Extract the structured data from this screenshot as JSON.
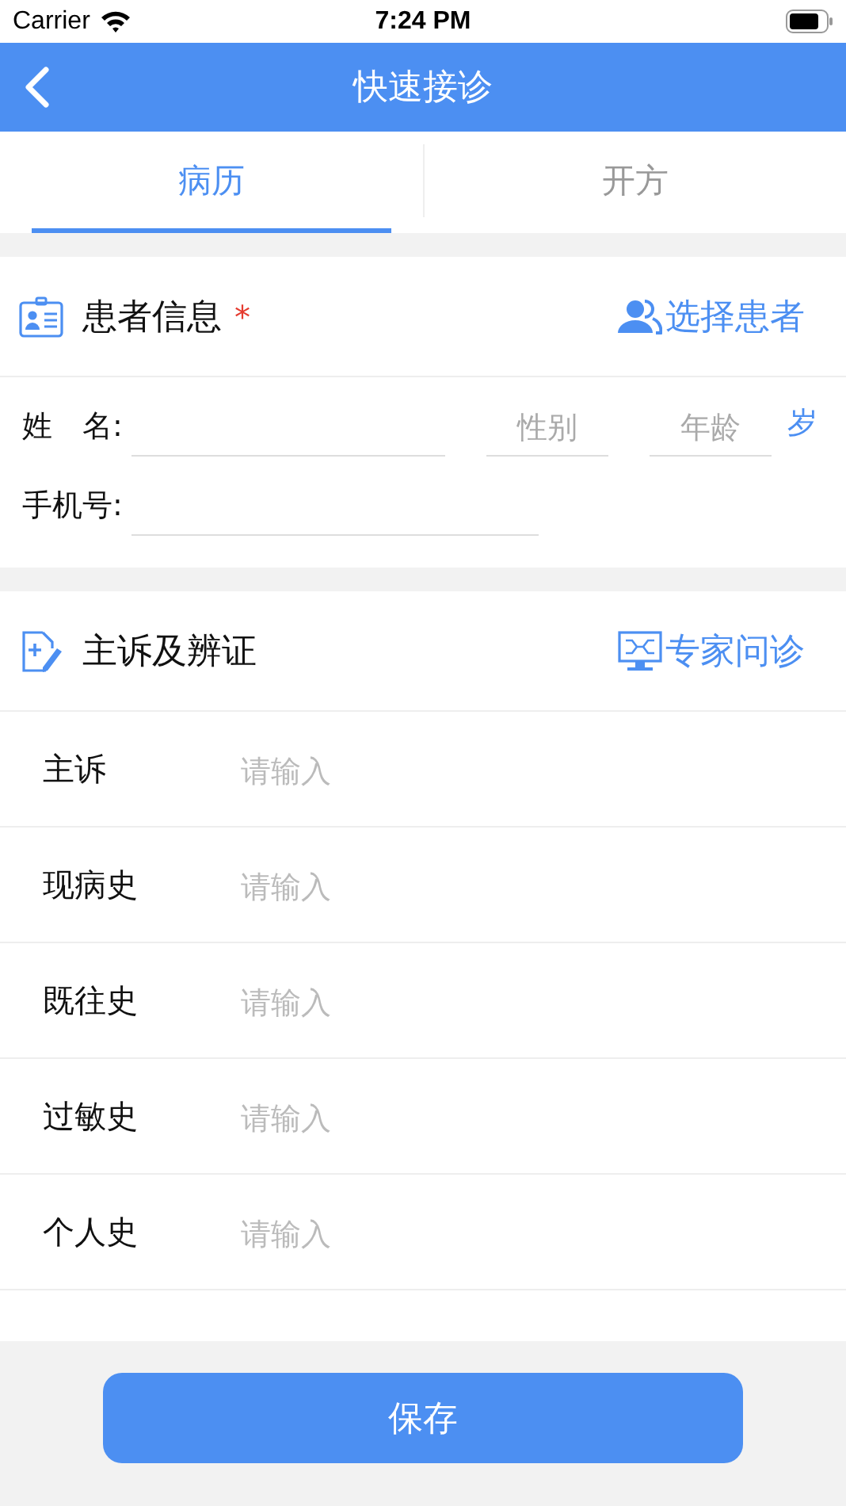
{
  "status_bar": {
    "carrier": "Carrier",
    "time": "7:24 PM"
  },
  "nav": {
    "title": "快速接诊"
  },
  "tabs": [
    {
      "label": "病历",
      "selected": true
    },
    {
      "label": "开方",
      "selected": false
    }
  ],
  "patient": {
    "title": "患者信息",
    "required_mark": "*",
    "action": "选择患者",
    "name_label": "姓　名:",
    "gender_placeholder": "性别",
    "age_placeholder": "年龄",
    "age_unit": "岁",
    "phone_label": "手机号:"
  },
  "complaint": {
    "title": "主诉及辨证",
    "action": "专家问诊",
    "rows": [
      {
        "label": "主诉",
        "placeholder": "请输入"
      },
      {
        "label": "现病史",
        "placeholder": "请输入"
      },
      {
        "label": "既往史",
        "placeholder": "请输入"
      },
      {
        "label": "过敏史",
        "placeholder": "请输入"
      },
      {
        "label": "个人史",
        "placeholder": "请输入"
      }
    ]
  },
  "save_button": "保存"
}
